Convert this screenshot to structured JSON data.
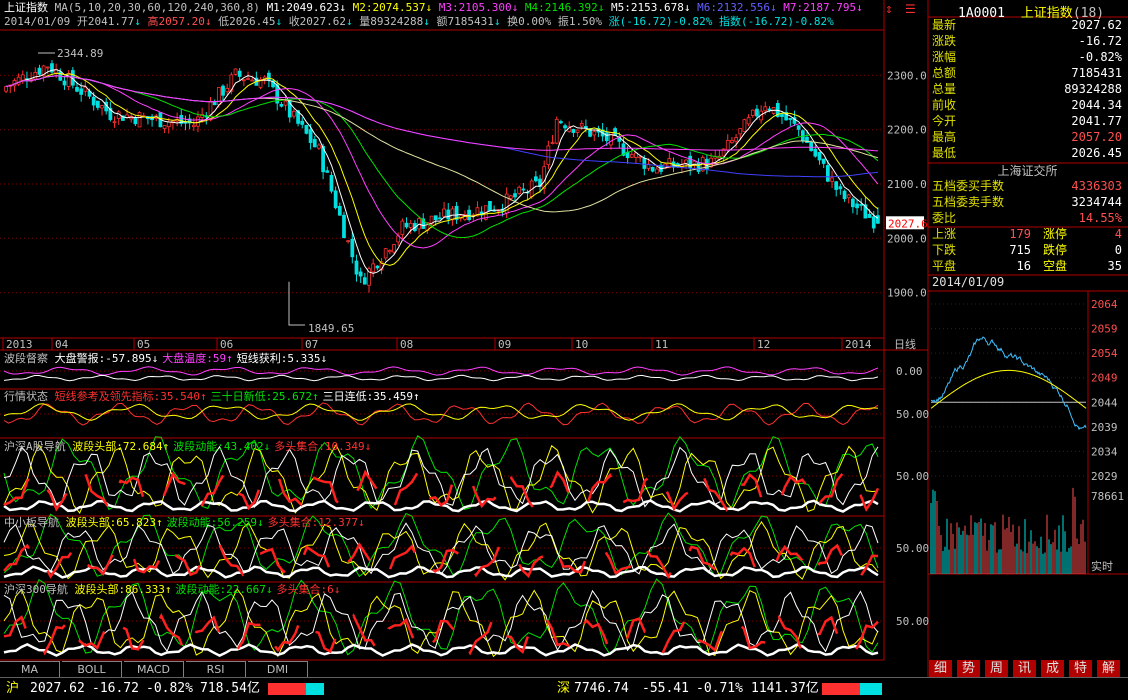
{
  "header": {
    "index_name": "上证指数",
    "ma_label": "MA(5,10,20,30,60,120,240,360,8)",
    "m1": "M1:2049.623",
    "m2": "M2:2074.537",
    "m3": "M3:2105.300",
    "m4": "M4:2146.392",
    "m5": "M5:2153.678",
    "m6": "M6:2132.556",
    "m7": "M7:2187.795",
    "date": "2014/01/09",
    "open": "开2041.77",
    "high": "高2057.20",
    "low": "低2026.45",
    "close": "收2027.62",
    "volume": "量89324288",
    "amount": "额7185431",
    "turnover": "换0.00%",
    "amplitude": "振1.50%",
    "change": "涨(-16.72)-0.82%",
    "index_change": "指数(-16.72)-0.82%"
  },
  "main_chart": {
    "price_axis": [
      "2300.0",
      "2200.0",
      "2100.0",
      "2000.0",
      "1900.0"
    ],
    "high_label": "2344.89",
    "low_label": "1849.65",
    "current_price_tag": "2027.6",
    "time_axis": [
      "2013",
      "04",
      "05",
      "06",
      "07",
      "08",
      "09",
      "10",
      "11",
      "12",
      "2014"
    ],
    "period_label": "日线"
  },
  "indicators": [
    {
      "title": "波段督察",
      "items": [
        {
          "text": "大盘警报:-57.895",
          "color": "#ffffff",
          "arrow": "↓"
        },
        {
          "text": "大盘温度:59",
          "color": "#ff40ff",
          "arrow": "↑"
        },
        {
          "text": "短线获利:5.335",
          "color": "#ffffff",
          "arrow": "↓"
        }
      ],
      "axis": [
        "0.00"
      ]
    },
    {
      "title": "行情状态",
      "items": [
        {
          "text": "短线参考及领先指标:35.540",
          "color": "#ff3030",
          "arrow": "↑"
        },
        {
          "text": "三十日新低:25.672",
          "color": "#00e000",
          "arrow": "↑"
        },
        {
          "text": "三日连低:35.459",
          "color": "#ffffff",
          "arrow": "↑"
        }
      ],
      "axis": [
        "50.00"
      ]
    },
    {
      "title": "沪深A股导航",
      "items": [
        {
          "text": "波段头部:72.684",
          "color": "#ffff00",
          "arrow": "↑"
        },
        {
          "text": "波段动能:43.402",
          "color": "#00e000",
          "arrow": "↓"
        },
        {
          "text": "多头集合:10.349",
          "color": "#ff3030",
          "arrow": "↓"
        }
      ],
      "axis": [
        "50.00"
      ]
    },
    {
      "title": "中小板导航",
      "items": [
        {
          "text": "波段头部:65.823",
          "color": "#ffff00",
          "arrow": "↑"
        },
        {
          "text": "波段动能:56.259",
          "color": "#00e000",
          "arrow": "↓"
        },
        {
          "text": "多头集合:12.377",
          "color": "#ff3030",
          "arrow": "↓"
        }
      ],
      "axis": [
        "50.00"
      ]
    },
    {
      "title": "沪深300导航",
      "items": [
        {
          "text": "波段头部:86.333",
          "color": "#ffff00",
          "arrow": "↑"
        },
        {
          "text": "波段动能:22.667",
          "color": "#00e000",
          "arrow": "↓"
        },
        {
          "text": "多头集合:6",
          "color": "#ff3030",
          "arrow": "↓"
        }
      ],
      "axis": [
        "50.00"
      ]
    }
  ],
  "bottom_tabs": [
    "MA",
    "BOLL",
    "MACD",
    "RSI",
    "DMI"
  ],
  "right_panel": {
    "code": "1A0001",
    "name": "上证指数",
    "count": "(18)",
    "rows": [
      {
        "k": "最新",
        "v": "2027.62",
        "color": "#ffffff"
      },
      {
        "k": "涨跌",
        "v": "-16.72",
        "color": "#ffffff"
      },
      {
        "k": "涨幅",
        "v": "-0.82%",
        "color": "#ffffff"
      },
      {
        "k": "总额",
        "v": "7185431",
        "color": "#ffffff"
      },
      {
        "k": "总量",
        "v": "89324288",
        "color": "#ffffff"
      },
      {
        "k": "前收",
        "v": "2044.34",
        "color": "#ffffff"
      },
      {
        "k": "今开",
        "v": "2041.77",
        "color": "#ffffff"
      },
      {
        "k": "最高",
        "v": "2057.20",
        "color": "#ff5050"
      },
      {
        "k": "最低",
        "v": "2026.45",
        "color": "#ffffff"
      }
    ],
    "exchange": "上海证交所",
    "buy_label": "五档委买手数",
    "buy_value": "4336303",
    "sell_label": "五档委卖手数",
    "sell_value": "3234744",
    "ratio_label": "委比",
    "ratio_value": "14.55%",
    "up_label": "上涨",
    "up_value": "179",
    "limit_up_label": "涨停",
    "limit_up_value": "4",
    "down_label": "下跌",
    "down_value": "715",
    "limit_down_label": "跌停",
    "limit_down_value": "0",
    "flat_label": "平盘",
    "flat_value": "16",
    "suspend_label": "空盘",
    "suspend_value": "35",
    "intraday_date": "2014/01/09",
    "intraday_axis": [
      "2064",
      "2059",
      "2054",
      "2049",
      "2044",
      "2039",
      "2034",
      "2029"
    ],
    "volume_axis": "78661",
    "realtime_label": "实时",
    "tabs": [
      "细",
      "势",
      "周",
      "讯",
      "成",
      "特",
      "解"
    ]
  },
  "status_bar": {
    "sh_label": "沪",
    "sh_price": "2027.62",
    "sh_change": "-16.72",
    "sh_pct": "-0.82%",
    "sh_amount": "718.54亿",
    "sz_label": "深",
    "sz_price": "7746.74",
    "sz_change": "-55.41",
    "sz_pct": "-0.71%",
    "sz_amount": "1141.37亿"
  },
  "colors": {
    "up": "#ff3030",
    "down": "#00e0e0",
    "axis": "#b00000",
    "label": "#e0e000"
  }
}
